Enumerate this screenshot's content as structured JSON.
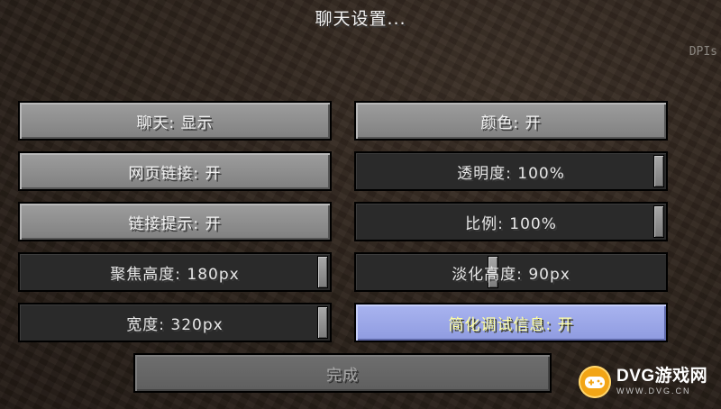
{
  "header": {
    "title": "聊天设置...",
    "corner_fragment": "DPIs"
  },
  "options": {
    "chat": {
      "label": "聊天: 显示"
    },
    "colors": {
      "label": "颜色: 开"
    },
    "web_links": {
      "label": "网页链接: 开"
    },
    "opacity": {
      "label": "透明度: 100%",
      "value_fraction": 1.0
    },
    "prompt_links": {
      "label": "链接提示: 开"
    },
    "scale": {
      "label": "比例: 100%",
      "value_fraction": 1.0
    },
    "focused_height": {
      "label": "聚焦高度: 180px",
      "value_fraction": 1.0
    },
    "unfocused_height": {
      "label": "淡化高度: 90px",
      "value_fraction": 0.44
    },
    "width": {
      "label": "宽度: 320px",
      "value_fraction": 1.0
    },
    "reduced_debug": {
      "label": "简化调试信息: 开"
    },
    "done": {
      "label": "完成"
    }
  },
  "watermark": {
    "main": "DVG游戏网",
    "sub": "WWW.DVG.CN",
    "icon": "gamepad-icon",
    "color": "#f2a516"
  }
}
